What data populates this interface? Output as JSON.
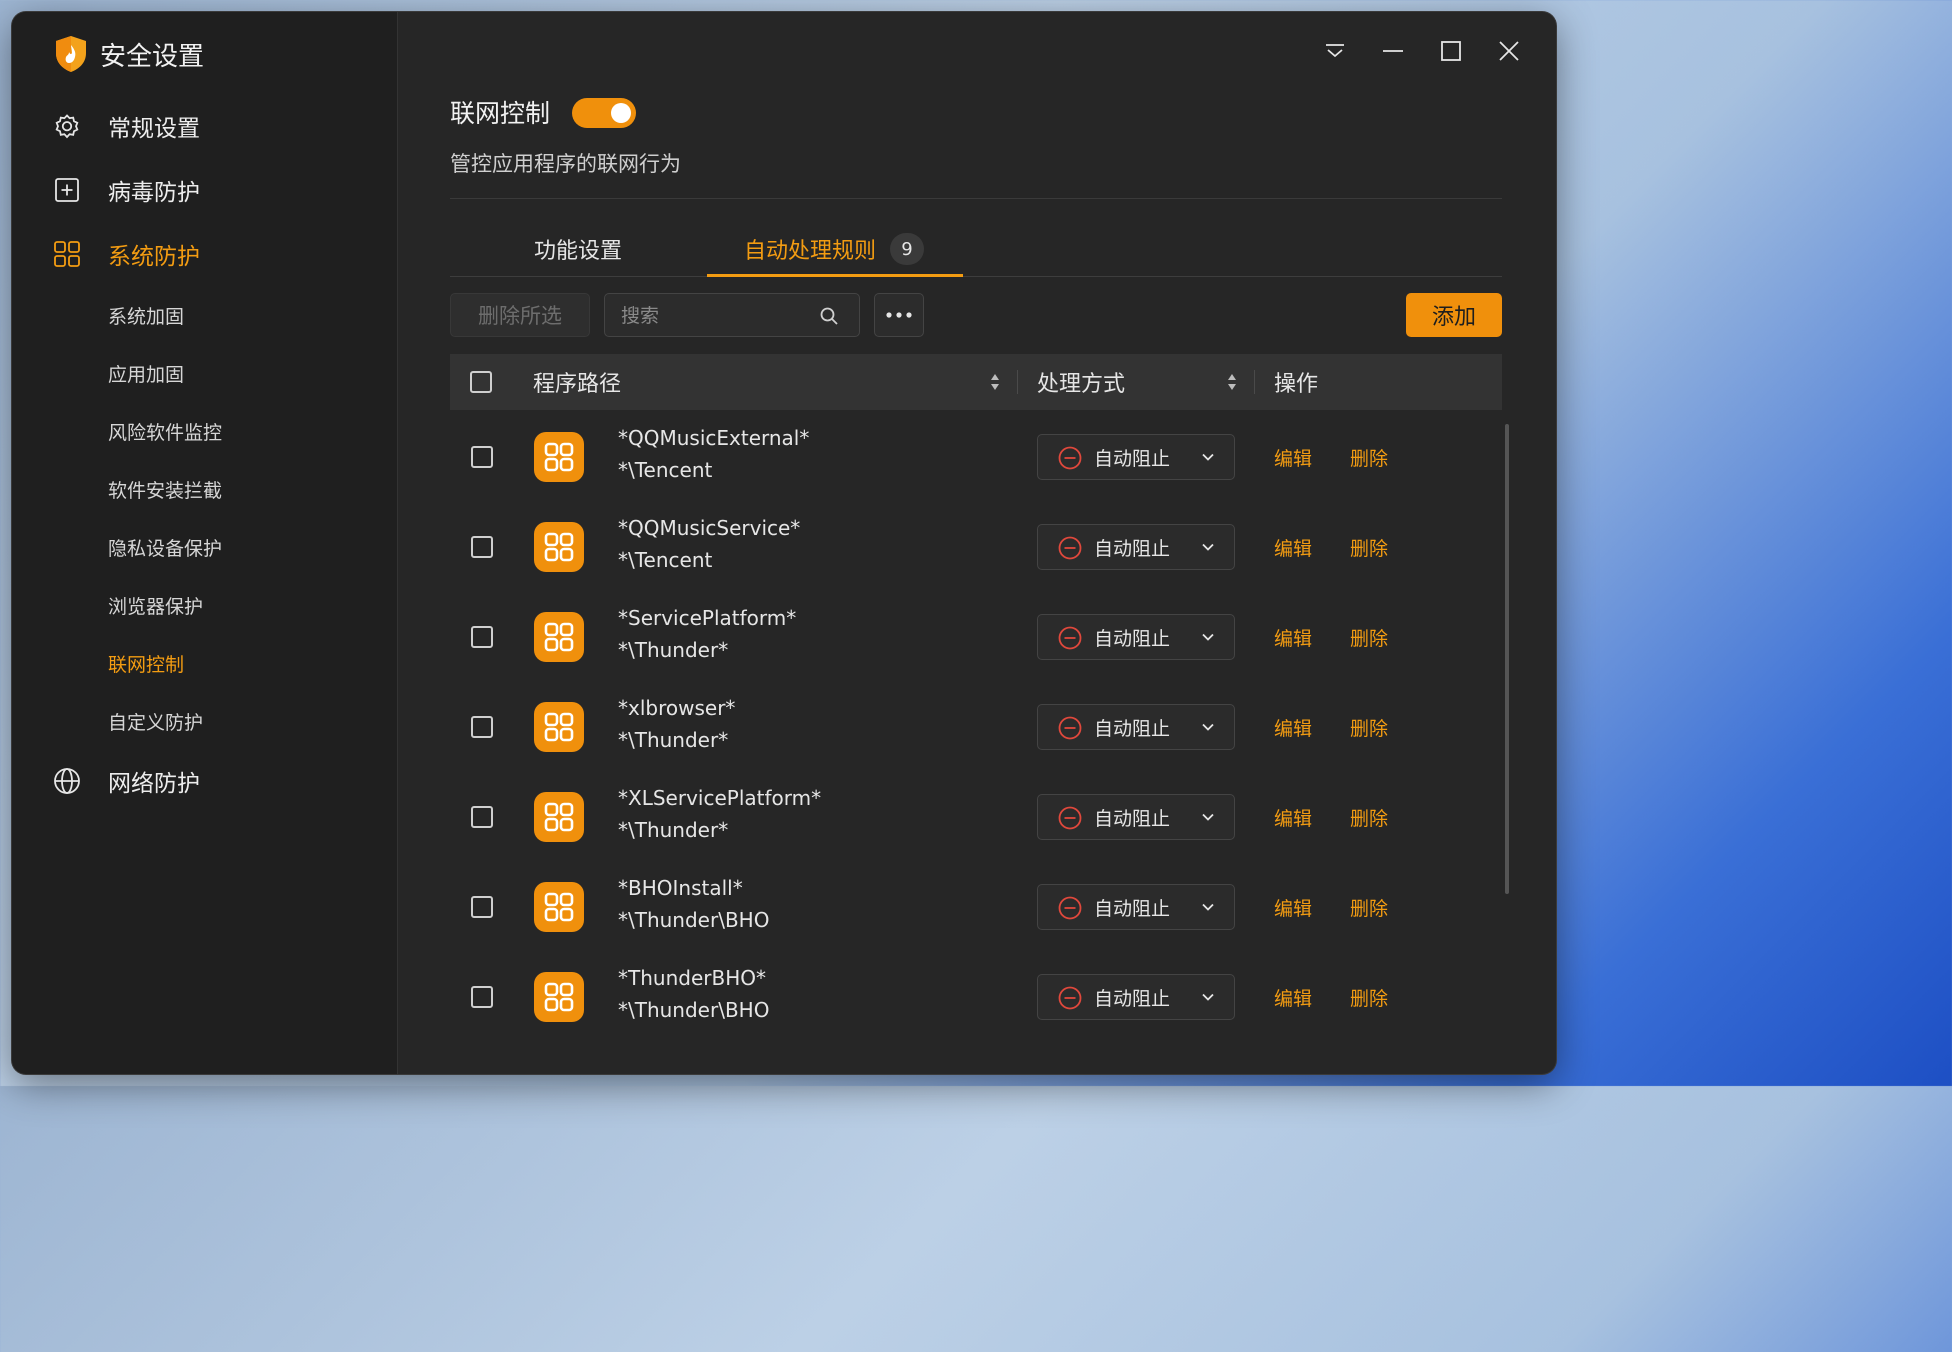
{
  "app": {
    "title": "安全设置"
  },
  "sidebar": {
    "main_items": [
      {
        "label": "常规设置",
        "icon": "gear-icon"
      },
      {
        "label": "病毒防护",
        "icon": "plus-square-icon"
      },
      {
        "label": "系统防护",
        "icon": "grid-icon",
        "active": true
      },
      {
        "label": "网络防护",
        "icon": "globe-icon"
      }
    ],
    "sub_items": [
      {
        "label": "系统加固"
      },
      {
        "label": "应用加固"
      },
      {
        "label": "风险软件监控"
      },
      {
        "label": "软件安装拦截"
      },
      {
        "label": "隐私设备保护"
      },
      {
        "label": "浏览器保护"
      },
      {
        "label": "联网控制",
        "active": true
      },
      {
        "label": "自定义防护"
      }
    ]
  },
  "header": {
    "feature_title": "联网控制",
    "toggle_on": true,
    "feature_desc": "管控应用程序的联网行为"
  },
  "tabs": [
    {
      "label": "功能设置"
    },
    {
      "label": "自动处理规则",
      "active": true,
      "badge": "9"
    }
  ],
  "toolbar": {
    "delete_selected": "删除所选",
    "search_placeholder": "搜索",
    "add_label": "添加"
  },
  "table": {
    "columns": [
      "程序路径",
      "处理方式",
      "操作"
    ],
    "rows": [
      {
        "path1": "*QQMusicExternal*",
        "path2": "*\\Tencent",
        "action": "自动阻止",
        "edit": "编辑",
        "delete": "删除"
      },
      {
        "path1": "*QQMusicService*",
        "path2": "*\\Tencent",
        "action": "自动阻止",
        "edit": "编辑",
        "delete": "删除"
      },
      {
        "path1": "*ServicePlatform*",
        "path2": "*\\Thunder*",
        "action": "自动阻止",
        "edit": "编辑",
        "delete": "删除"
      },
      {
        "path1": "*xlbrowser*",
        "path2": "*\\Thunder*",
        "action": "自动阻止",
        "edit": "编辑",
        "delete": "删除"
      },
      {
        "path1": "*XLServicePlatform*",
        "path2": "*\\Thunder*",
        "action": "自动阻止",
        "edit": "编辑",
        "delete": "删除"
      },
      {
        "path1": "*BHOInstall*",
        "path2": "*\\Thunder\\BHO",
        "action": "自动阻止",
        "edit": "编辑",
        "delete": "删除"
      },
      {
        "path1": "*ThunderBHO*",
        "path2": "*\\Thunder\\BHO",
        "action": "自动阻止",
        "edit": "编辑",
        "delete": "删除"
      }
    ]
  },
  "colors": {
    "accent": "#f0900c",
    "block_red": "#e0483c",
    "bg_main": "#262626",
    "bg_sidebar": "#1f1f1f"
  }
}
